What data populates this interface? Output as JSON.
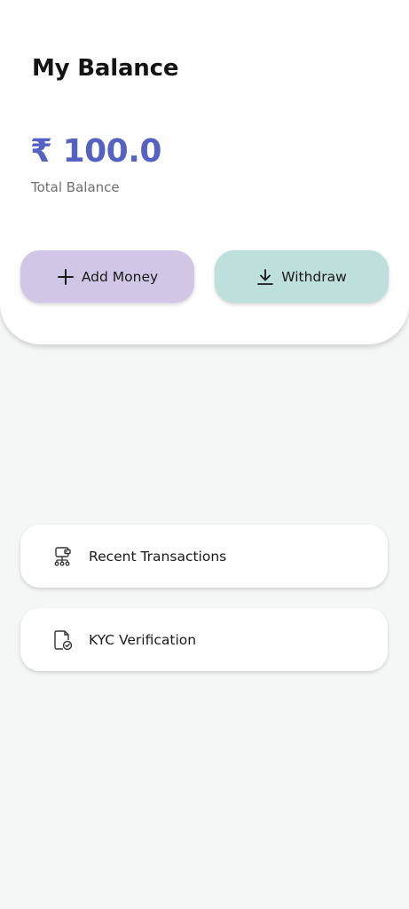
{
  "header": {
    "title": "My Balance"
  },
  "balance": {
    "amount": "₹ 100.0",
    "label": "Total Balance"
  },
  "actions": {
    "add_money_label": "Add Money",
    "withdraw_label": "Withdraw",
    "add_money_color": "#d1c6e6",
    "withdraw_color": "#bde0dc"
  },
  "menu": {
    "items": [
      {
        "label": "Recent Transactions",
        "icon": "transactions-icon"
      },
      {
        "label": "KYC Verification",
        "icon": "kyc-document-check-icon"
      }
    ]
  },
  "colors": {
    "accent": "#5662c3",
    "background": "#f5f7f6"
  }
}
